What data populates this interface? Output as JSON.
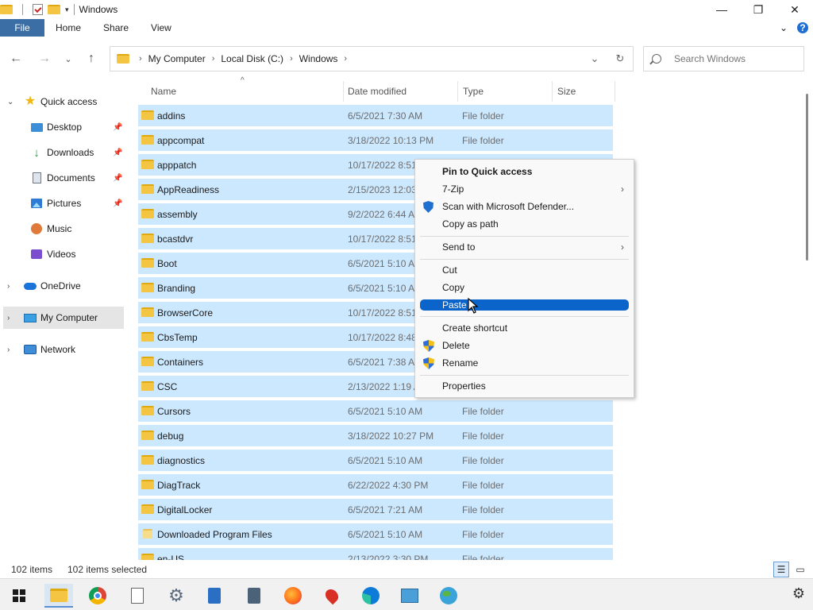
{
  "window": {
    "title": "Windows",
    "controls": {
      "minimize": "—",
      "maximize": "❐",
      "close": "✕"
    }
  },
  "ribbon": {
    "file": "File",
    "tabs": [
      "Home",
      "Share",
      "View"
    ],
    "expand": "⌄",
    "help": "?"
  },
  "nav": {
    "back": "←",
    "forward": "→",
    "recent": "⌄",
    "up": "↑"
  },
  "address": {
    "crumbs": [
      "My Computer",
      "Local Disk (C:)",
      "Windows"
    ],
    "dropdown": "⌄",
    "refresh": "↻"
  },
  "search": {
    "placeholder": "Search Windows"
  },
  "sidebar": {
    "quick_access": "Quick access",
    "items": [
      {
        "label": "Desktop",
        "icon": "desktop-icon"
      },
      {
        "label": "Downloads",
        "icon": "downloads-icon"
      },
      {
        "label": "Documents",
        "icon": "documents-icon"
      },
      {
        "label": "Pictures",
        "icon": "pictures-icon"
      },
      {
        "label": "Music",
        "icon": "music-icon"
      },
      {
        "label": "Videos",
        "icon": "videos-icon"
      }
    ],
    "onedrive": "OneDrive",
    "my_computer": "My Computer",
    "network": "Network"
  },
  "columns": {
    "name": "Name",
    "date": "Date modified",
    "type": "Type",
    "size": "Size"
  },
  "files": [
    {
      "name": "addins",
      "date": "6/5/2021 7:30 AM",
      "type": "File folder"
    },
    {
      "name": "appcompat",
      "date": "3/18/2022 10:13 PM",
      "type": "File folder"
    },
    {
      "name": "apppatch",
      "date": "10/17/2022 8:51",
      "type": ""
    },
    {
      "name": "AppReadiness",
      "date": "2/15/2023 12:03",
      "type": ""
    },
    {
      "name": "assembly",
      "date": "9/2/2022 6:44 AI",
      "type": ""
    },
    {
      "name": "bcastdvr",
      "date": "10/17/2022 8:51",
      "type": ""
    },
    {
      "name": "Boot",
      "date": "6/5/2021 5:10 AI",
      "type": ""
    },
    {
      "name": "Branding",
      "date": "6/5/2021 5:10 AI",
      "type": ""
    },
    {
      "name": "BrowserCore",
      "date": "10/17/2022 8:51",
      "type": ""
    },
    {
      "name": "CbsTemp",
      "date": "10/17/2022 8:48",
      "type": ""
    },
    {
      "name": "Containers",
      "date": "6/5/2021 7:38 AI",
      "type": ""
    },
    {
      "name": "CSC",
      "date": "2/13/2022 1:19 A",
      "type": ""
    },
    {
      "name": "Cursors",
      "date": "6/5/2021 5:10 AM",
      "type": "File folder"
    },
    {
      "name": "debug",
      "date": "3/18/2022 10:27 PM",
      "type": "File folder"
    },
    {
      "name": "diagnostics",
      "date": "6/5/2021 5:10 AM",
      "type": "File folder"
    },
    {
      "name": "DiagTrack",
      "date": "6/22/2022 4:30 PM",
      "type": "File folder"
    },
    {
      "name": "DigitalLocker",
      "date": "6/5/2021 7:21 AM",
      "type": "File folder"
    },
    {
      "name": "Downloaded Program Files",
      "date": "6/5/2021 5:10 AM",
      "type": "File folder"
    },
    {
      "name": "en-US",
      "date": "2/13/2022 3:30 PM",
      "type": "File folder"
    }
  ],
  "context_menu": {
    "pin": "Pin to Quick access",
    "zip": "7-Zip",
    "scan": "Scan with Microsoft Defender...",
    "copy_path": "Copy as path",
    "send_to": "Send to",
    "cut": "Cut",
    "copy": "Copy",
    "paste": "Paste",
    "create_shortcut": "Create shortcut",
    "delete": "Delete",
    "rename": "Rename",
    "properties": "Properties",
    "submenu_arrow": "›"
  },
  "status": {
    "items": "102 items",
    "selected": "102 items selected"
  },
  "taskbar": {
    "apps": [
      "start-icon",
      "file-explorer-icon",
      "chrome-icon",
      "blank-file-icon",
      "settings-gear-icon",
      "notepad-icon",
      "calculator-icon",
      "firefox-icon",
      "maps-pin-icon",
      "edge-icon",
      "control-panel-icon",
      "globe-icon"
    ],
    "gear": "⚙"
  },
  "colors": {
    "accent": "#3a6ea5",
    "selection": "#cce8ff",
    "menu_hover": "#0a64c9"
  }
}
